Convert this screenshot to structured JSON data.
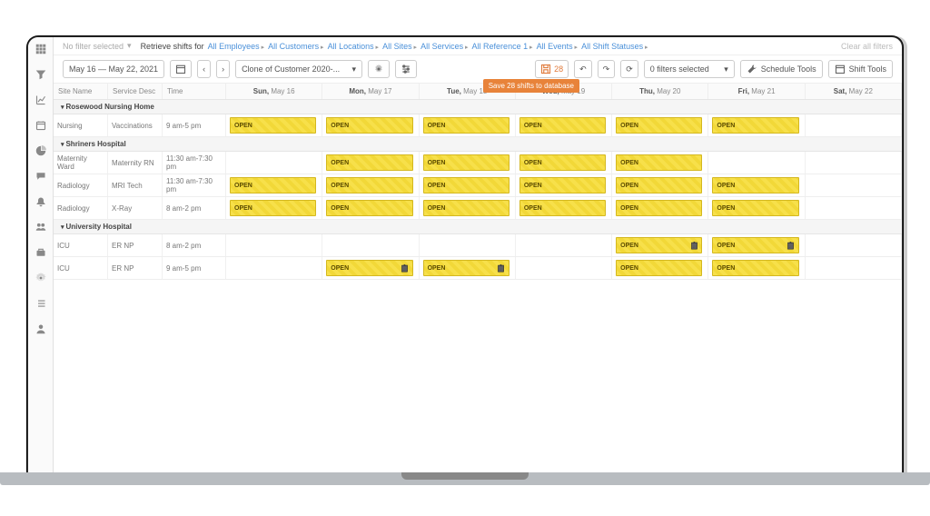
{
  "topbar": {
    "no_filter": "No filter selected",
    "retrieve": "Retrieve shifts for",
    "filters": [
      "All Employees",
      "All Customers",
      "All Locations",
      "All Sites",
      "All Services",
      "All Reference 1",
      "All Events",
      "All Shift Statuses"
    ],
    "clear": "Clear all filters"
  },
  "toolbar": {
    "date_range": "May 16 — May 22, 2021",
    "customer": "Clone of Customer 2020-...",
    "save_count": "28",
    "tooltip": "Save 28 shifts to database",
    "filters_sel": "0 filters selected",
    "schedule_tools": "Schedule Tools",
    "shift_tools": "Shift Tools"
  },
  "columns": {
    "site": "Site Name",
    "service": "Service Desc",
    "time": "Time",
    "days": [
      {
        "d": "Sun,",
        "n": "May 16"
      },
      {
        "d": "Mon,",
        "n": "May 17"
      },
      {
        "d": "Tue,",
        "n": "May 18"
      },
      {
        "d": "Wed,",
        "n": "May 19"
      },
      {
        "d": "Thu,",
        "n": "May 20"
      },
      {
        "d": "Fri,",
        "n": "May 21"
      },
      {
        "d": "Sat,",
        "n": "May 22"
      }
    ]
  },
  "open_label": "OPEN",
  "groups": [
    {
      "name": "Rosewood Nursing Home",
      "rows": [
        {
          "site": "Nursing",
          "service": "Vaccinations",
          "time": "9 am-5 pm",
          "shifts": [
            1,
            1,
            1,
            1,
            1,
            1,
            0
          ]
        }
      ]
    },
    {
      "name": "Shriners Hospital",
      "rows": [
        {
          "site": "Maternity Ward",
          "service": "Maternity RN",
          "time": "11:30 am-7:30 pm",
          "shifts": [
            0,
            1,
            1,
            1,
            1,
            0,
            0
          ]
        },
        {
          "site": "Radiology",
          "service": "MRI Tech",
          "time": "11:30 am-7:30 pm",
          "shifts": [
            1,
            1,
            1,
            1,
            1,
            1,
            0
          ]
        },
        {
          "site": "Radiology",
          "service": "X-Ray",
          "time": "8 am-2 pm",
          "shifts": [
            1,
            1,
            1,
            1,
            1,
            1,
            0
          ]
        }
      ]
    },
    {
      "name": "University Hospital",
      "rows": [
        {
          "site": "ICU",
          "service": "ER NP",
          "time": "8 am-2 pm",
          "shifts": [
            0,
            0,
            0,
            0,
            2,
            2,
            0
          ]
        },
        {
          "site": "ICU",
          "service": "ER NP",
          "time": "9 am-5 pm",
          "shifts": [
            0,
            2,
            2,
            0,
            1,
            1,
            0
          ]
        }
      ]
    }
  ]
}
